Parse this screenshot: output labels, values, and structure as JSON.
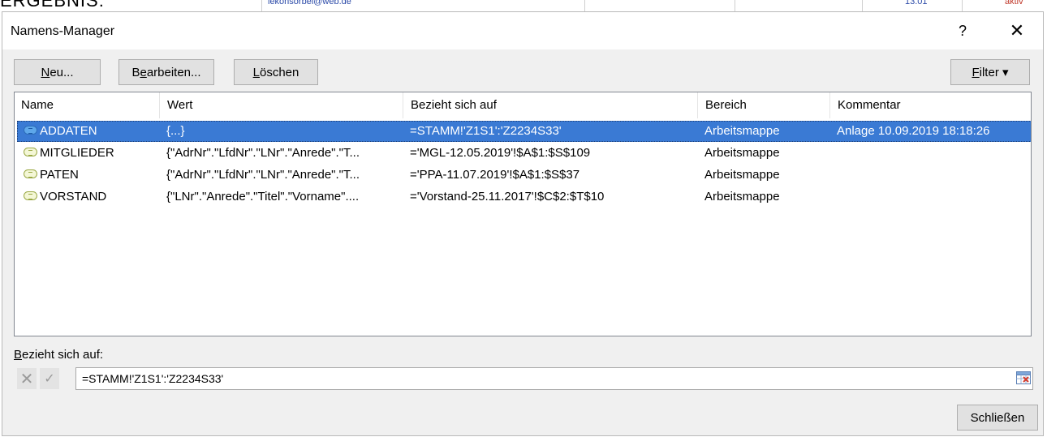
{
  "background": {
    "partial_heading": "ERGEBNIS:",
    "partial_cells": [
      "lekonsorbel@web.de",
      "13.01",
      "aktiv"
    ]
  },
  "dialog": {
    "title": "Namens-Manager",
    "help_glyph": "?",
    "close_glyph": "✕"
  },
  "toolbar": {
    "new_prefix": "",
    "new_mnemonic": "N",
    "new_suffix": "eu...",
    "edit_prefix": "B",
    "edit_mnemonic": "e",
    "edit_suffix": "arbeiten...",
    "delete_prefix": "",
    "delete_mnemonic": "L",
    "delete_suffix": "öschen",
    "filter_prefix": "",
    "filter_mnemonic": "F",
    "filter_suffix": "ilter ▾"
  },
  "table": {
    "columns": [
      "Name",
      "Wert",
      "Bezieht sich auf",
      "Bereich",
      "Kommentar"
    ],
    "rows": [
      {
        "name": "ADDATEN",
        "wert": "{...}",
        "bezug": "=STAMM!'Z1S1':'Z2234S33'",
        "bereich": "Arbeitsmappe",
        "kommentar": "Anlage 10.09.2019 18:18:26",
        "selected": true
      },
      {
        "name": "MITGLIEDER",
        "wert": "{\"AdrNr\".\"LfdNr\".\"LNr\".\"Anrede\".\"T...",
        "bezug": "='MGL-12.05.2019'!$A$1:$S$109",
        "bereich": "Arbeitsmappe",
        "kommentar": "",
        "selected": false
      },
      {
        "name": "PATEN",
        "wert": "{\"AdrNr\".\"LfdNr\".\"LNr\".\"Anrede\".\"T...",
        "bezug": "='PPA-11.07.2019'!$A$1:$S$37",
        "bereich": "Arbeitsmappe",
        "kommentar": "",
        "selected": false
      },
      {
        "name": "VORSTAND",
        "wert": "{\"LNr\".\"Anrede\".\"Titel\".\"Vorname\"....",
        "bezug": "='Vorstand-25.11.2017'!$C$2:$T$10",
        "bereich": "Arbeitsmappe",
        "kommentar": "",
        "selected": false
      }
    ]
  },
  "reference": {
    "label_mnemonic": "B",
    "label_rest": "ezieht sich auf:",
    "value": "=STAMM!'Z1S1':'Z2234S33'"
  },
  "footer": {
    "close_label": "Schließen"
  },
  "colors": {
    "selection": "#3a7ad4",
    "dialog_bg": "#f0f0f0",
    "button_bg": "#e1e1e1"
  }
}
